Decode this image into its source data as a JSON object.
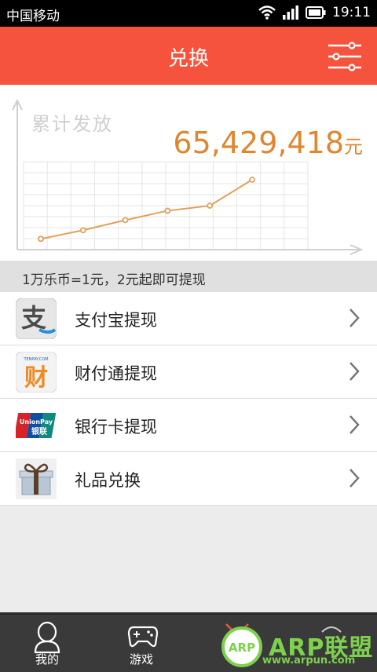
{
  "status_bar": {
    "carrier": "中国移动",
    "time": "19:11"
  },
  "header": {
    "title": "兑换",
    "filter_icon": "filter-sliders-icon"
  },
  "summary": {
    "label": "累计发放",
    "amount": "65,429,418",
    "unit": "元"
  },
  "trend_points": [
    0.04,
    0.16,
    0.3,
    0.43,
    0.5,
    0.86
  ],
  "rate_note": "1万乐币=1元，2元起即可提现",
  "menu": [
    {
      "label": "支付宝提现",
      "icon": "alipay-icon"
    },
    {
      "label": "财付通提现",
      "icon": "tenpay-icon"
    },
    {
      "label": "银行卡提现",
      "icon": "unionpay-icon"
    },
    {
      "label": "礼品兑换",
      "icon": "gift-icon"
    }
  ],
  "icon_text": {
    "alipay": "支",
    "tenpay_small": "TENPAY.COM",
    "tenpay": "财",
    "unionpay": "UnionPay",
    "unionpay_cn": "银联"
  },
  "tabs": [
    {
      "label": "我的",
      "icon": "user-icon"
    },
    {
      "label": "游戏",
      "icon": "gamepad-icon"
    }
  ],
  "watermark": {
    "badge": "ARP",
    "text": "ARP联盟",
    "url": "www.arpun.com"
  },
  "colors": {
    "accent": "#f5533d",
    "amount": "#e0862f",
    "chart_line": "#e2a05a"
  }
}
